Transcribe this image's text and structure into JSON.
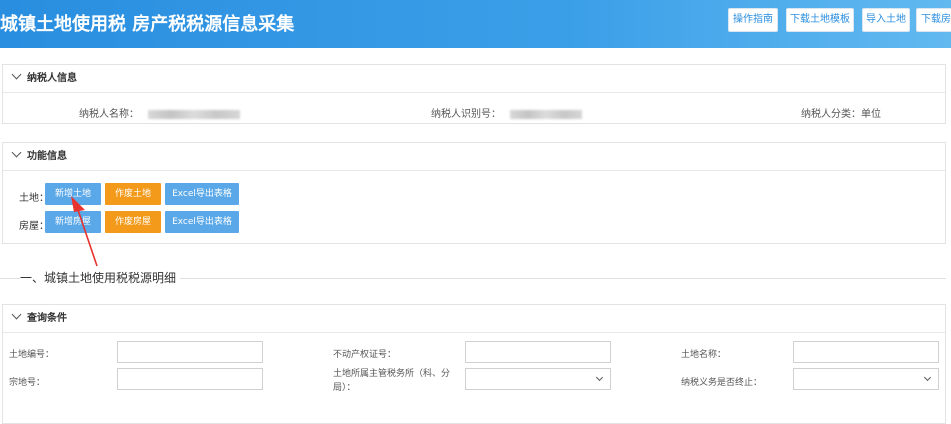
{
  "header": {
    "title": "城镇土地使用税 房产税税源信息采集",
    "buttons": [
      "操作指南",
      "下载土地模板",
      "导入土地",
      "下载房"
    ]
  },
  "taxpayer": {
    "section_title": "纳税人信息",
    "name_label": "纳税人名称：",
    "id_label": "纳税人识别号：",
    "category_label": "纳税人分类：",
    "category_value": "单位"
  },
  "functions": {
    "section_title": "功能信息",
    "land_label": "土地：",
    "house_label": "房屋：",
    "land_buttons": [
      "新增土地",
      "作废土地",
      "Excel导出表格"
    ],
    "house_buttons": [
      "新增房屋",
      "作废房屋",
      "Excel导出表格"
    ],
    "colors": {
      "blue": "#5aa8e8",
      "orange": "#f39a1a",
      "arrow": "#e8322e"
    }
  },
  "detail": {
    "title": "一、城镇土地使用税税源明细"
  },
  "query": {
    "section_title": "查询条件",
    "fields": {
      "land_no": {
        "label": "土地编号：",
        "value": ""
      },
      "property_cert": {
        "label": "不动产权证号：",
        "value": ""
      },
      "land_name": {
        "label": "土地名称：",
        "value": ""
      },
      "parcel_no": {
        "label": "宗地号：",
        "value": ""
      },
      "tax_office": {
        "label": "土地所属主管税务所（科、分局）：",
        "value": ""
      },
      "obligation_end": {
        "label": "纳税义务是否终止：",
        "value": ""
      }
    }
  }
}
